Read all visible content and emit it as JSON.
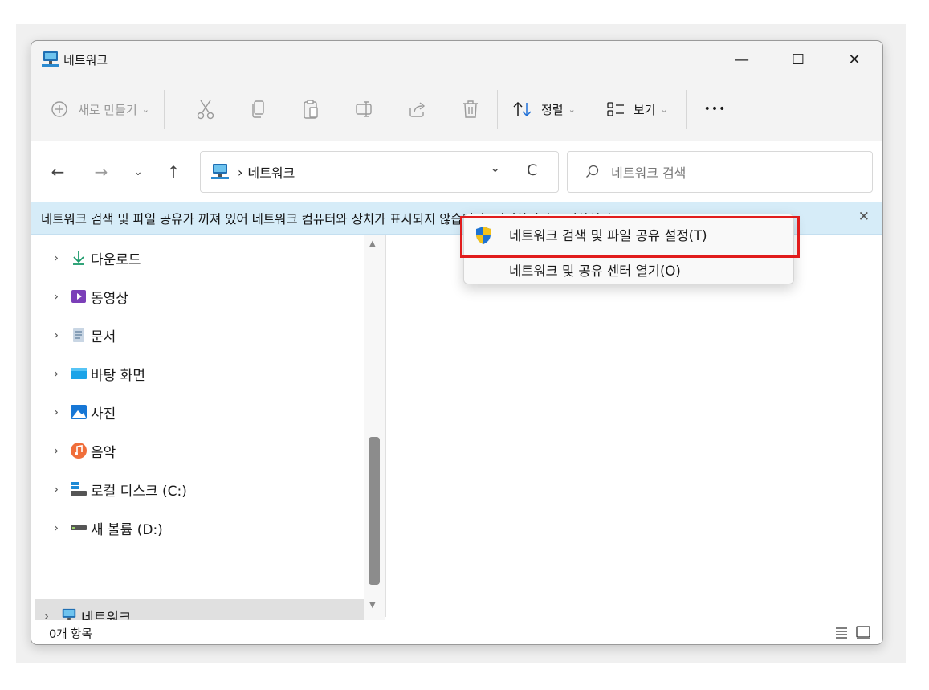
{
  "window": {
    "title": "네트워크",
    "minimize": "—",
    "maximize": "☐",
    "close": "✕"
  },
  "toolbar": {
    "new_label": "새로 만들기",
    "sort_label": "정렬",
    "view_label": "보기",
    "more": "•••"
  },
  "nav": {
    "back": "←",
    "forward": "→",
    "recent": "⌄",
    "up": "↑"
  },
  "address": {
    "separator": "›",
    "location": "네트워크",
    "dropdown": "⌄",
    "refresh": "C"
  },
  "search": {
    "placeholder": "네트워크 검색"
  },
  "infobar": {
    "message": "네트워크 검색 및 파일 공유가 꺼져 있어 네트워크 컴퓨터와 장치가 표시되지 않습니다. 변경하려면 클릭하십시오.",
    "close": "✕"
  },
  "sidebar": {
    "items": [
      {
        "label": "다운로드",
        "icon": "download-icon"
      },
      {
        "label": "동영상",
        "icon": "video-icon"
      },
      {
        "label": "문서",
        "icon": "document-icon"
      },
      {
        "label": "바탕 화면",
        "icon": "desktop-icon"
      },
      {
        "label": "사진",
        "icon": "pictures-icon"
      },
      {
        "label": "음악",
        "icon": "music-icon"
      },
      {
        "label": "로컬 디스크 (C:)",
        "icon": "local-disk-icon"
      },
      {
        "label": "새 볼륨 (D:)",
        "icon": "drive-icon"
      },
      {
        "label": "네트워크",
        "icon": "network-icon",
        "selected": true
      }
    ]
  },
  "status": {
    "item_count": "0개 항목"
  },
  "context_menu": {
    "items": [
      {
        "label": "네트워크 검색 및 파일 공유 설정(T)",
        "icon": "uac-shield-icon"
      },
      {
        "label": "네트워크 및 공유 센터 열기(O)"
      }
    ]
  },
  "colors": {
    "infobar": "#d6ecf8",
    "highlight": "#e11c1c",
    "selected_item": "#e0e0e0"
  }
}
